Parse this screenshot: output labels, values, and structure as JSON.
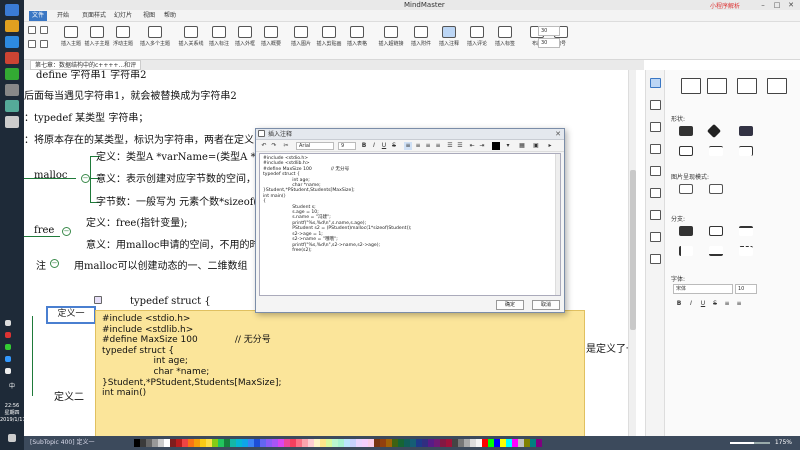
{
  "app": {
    "title": "MindMaster",
    "title_right": "小程序解析",
    "win_minimize": "–",
    "win_maximize": "□",
    "win_close": "✕"
  },
  "menu": {
    "tabs": [
      "文件",
      "开始",
      "页面样式",
      "幻灯片",
      "视图",
      "帮助"
    ],
    "active": 0
  },
  "ribbon": {
    "groups": [
      {
        "label": "插入主题"
      },
      {
        "label": "插入子主题"
      },
      {
        "label": "浮动主题"
      },
      {
        "label": "插入多个主题"
      },
      {
        "label": "插入关系线"
      },
      {
        "label": "插入标注"
      },
      {
        "label": "插入外框"
      },
      {
        "label": "插入概要"
      },
      {
        "label": "插入图片"
      },
      {
        "label": "插入剪贴画"
      },
      {
        "label": "插入表格"
      },
      {
        "label": "插入超链接"
      },
      {
        "label": "插入附件"
      },
      {
        "label": "插入注释"
      },
      {
        "label": "插入评论"
      },
      {
        "label": "插入标签"
      },
      {
        "label": "布局"
      },
      {
        "label": "编号"
      }
    ],
    "spin1": "30",
    "spin2": "30"
  },
  "document_tab": {
    "label": "第七章：数据结构中的c++++...和评"
  },
  "canvas": {
    "lines": [
      "define 字符串1 字符串2",
      "后面每当遇见字符串1，就会被替换成为字符串2",
      "：typedef 某类型 字符串；",
      "：将原本存在的某类型，标识为字符串，两者在定义"
    ],
    "malloc_label": "malloc",
    "malloc_rows": [
      "定义：类型A *varName=(类型A *)ma",
      "意义：表示创建对应字节数的空间，交",
      "字节数：一般写为 元素个数*sizeof("
    ],
    "free_label": "free",
    "free_rows": [
      "定义：free(指针变量);",
      "意义：用malloc申请的空间，不用的时候"
    ],
    "note_label": "注",
    "note_text": "用malloc可以创建动态的一、二维数组",
    "def1_label": "定义一",
    "def2_label": "定义二",
    "typedef_text": "typedef struct {",
    "right_text": "是定义了一个"
  },
  "note_tooltip": {
    "lines": [
      "#include <stdio.h>",
      "#include <stdlib.h>",
      "",
      "#define MaxSize 100             // 无分号",
      "",
      "typedef struct {",
      "                  int age;",
      "                  char *name;",
      "}Student,*PStudent,Students[MaxSize];",
      "int main()"
    ]
  },
  "dialog": {
    "title": "插入注释",
    "font_name": "Arial",
    "font_size": "9",
    "ok_label": "确定",
    "cancel_label": "取消",
    "code_lines": [
      "#include <stdio.h>",
      "#include <stdlib.h>",
      "",
      "#define MaxSize 100             // 无分号",
      "",
      "typedef struct {",
      "                    int age;",
      "                    char *name;",
      "}Student,*PStudent,Students[MaxSize];",
      "int main()",
      "",
      "{",
      "",
      "                    Student s;",
      "                    s.age = 10;",
      "                    s.name = \"冯建\";",
      "                    printf(\"%s,%d\\n\",s.name,s.age);",
      "",
      "                    PStudent s2 = (PStudent)malloc(1*sizeof(Student));",
      "                    s2->age = 1;",
      "                    s2->name = \"哦哦\";",
      "                    printf(\"%s,%d\\n\",s2->name,s2->age);",
      "                    free(s2);"
    ]
  },
  "right_panel": {
    "shape_label": "形状:",
    "image_fill_label": "图片呈现模式:",
    "branch_label": "分支:",
    "font_label": "字体:",
    "font_name": "宋体",
    "font_size": "10"
  },
  "statusbar": {
    "left_text": "[SubTopic 400]  定义一",
    "zoom_text": "175%",
    "zoom_fraction": 0.6,
    "palette": [
      "#000000",
      "#3b3b3b",
      "#666666",
      "#999999",
      "#cccccc",
      "#ffffff",
      "#7f1d1d",
      "#b91c1c",
      "#ef4444",
      "#f97316",
      "#f59e0b",
      "#facc15",
      "#fde047",
      "#84cc16",
      "#22c55e",
      "#15803d",
      "#14b8a6",
      "#06b6d4",
      "#0ea5e9",
      "#3b82f6",
      "#1d4ed8",
      "#6366f1",
      "#8b5cf6",
      "#a855f7",
      "#d946ef",
      "#ec4899",
      "#f43f5e",
      "#fb7185",
      "#fda4af",
      "#fecdd3",
      "#fef3c7",
      "#fde68a",
      "#d9f99d",
      "#bbf7d0",
      "#a7f3d0",
      "#bae6fd",
      "#c7d2fe",
      "#e9d5ff",
      "#f5d0fe",
      "#fbcfe8",
      "#78350f",
      "#92400e",
      "#a16207",
      "#3f6212",
      "#166534",
      "#115e59",
      "#155e75",
      "#1e3a8a",
      "#312e81",
      "#581c87",
      "#701a75",
      "#831843",
      "#9f1239",
      "#444444",
      "#777777",
      "#aaaaaa",
      "#dddddd",
      "#f5f5f5",
      "#ff0000",
      "#00ff00",
      "#0000ff",
      "#ffff00",
      "#00ffff",
      "#ff00ff",
      "#c0c0c0",
      "#808000",
      "#008080",
      "#800080"
    ]
  },
  "taskbar": {
    "time": "22:56",
    "weekday": "星期四",
    "date": "2019/1/17",
    "lang": "中"
  }
}
